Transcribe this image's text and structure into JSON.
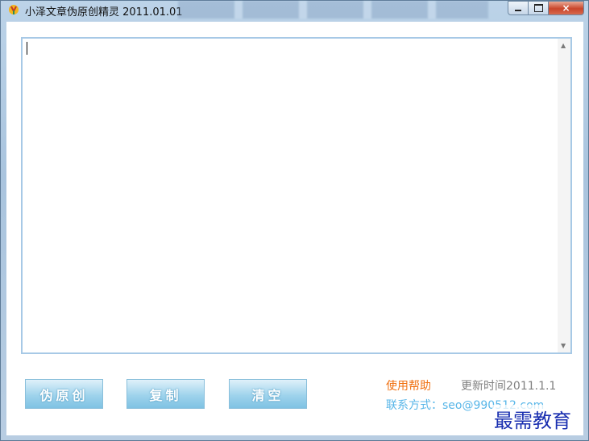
{
  "window": {
    "title": "小泽文章伪原创精灵 2011.01.01",
    "controls": {
      "minimize": "minimize-icon",
      "maximize": "maximize-icon",
      "close": "×"
    }
  },
  "editor": {
    "value": ""
  },
  "buttons": {
    "rewrite": "伪原创",
    "copy": "复制",
    "clear": "清空"
  },
  "info": {
    "help": "使用帮助",
    "update": "更新时间2011.1.1",
    "contact": "联系方式：seo@990512.com"
  },
  "watermark": "最需教育",
  "colors": {
    "accent_orange": "#f07010",
    "link_blue": "#58b6e8",
    "button_blue": "#9fd3ec"
  }
}
